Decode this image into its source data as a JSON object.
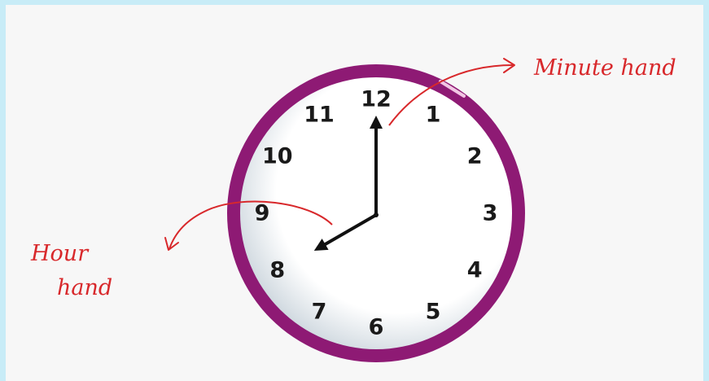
{
  "labels": {
    "minute_hand": "Minute hand",
    "hour_hand_line1": "Hour",
    "hour_hand_line2": "hand"
  },
  "clock": {
    "numbers": [
      "12",
      "1",
      "2",
      "3",
      "4",
      "5",
      "6",
      "7",
      "8",
      "9",
      "10",
      "11"
    ],
    "time": {
      "hour": 8,
      "minute": 0
    }
  },
  "colors": {
    "background": "#c8ecf7",
    "panel": "#f7f7f7",
    "rim": "#8e1a74",
    "face_shadow": "#cfd8df",
    "numbers": "#1a1a1a",
    "hands": "#111111",
    "annotation": "#d8282b"
  }
}
